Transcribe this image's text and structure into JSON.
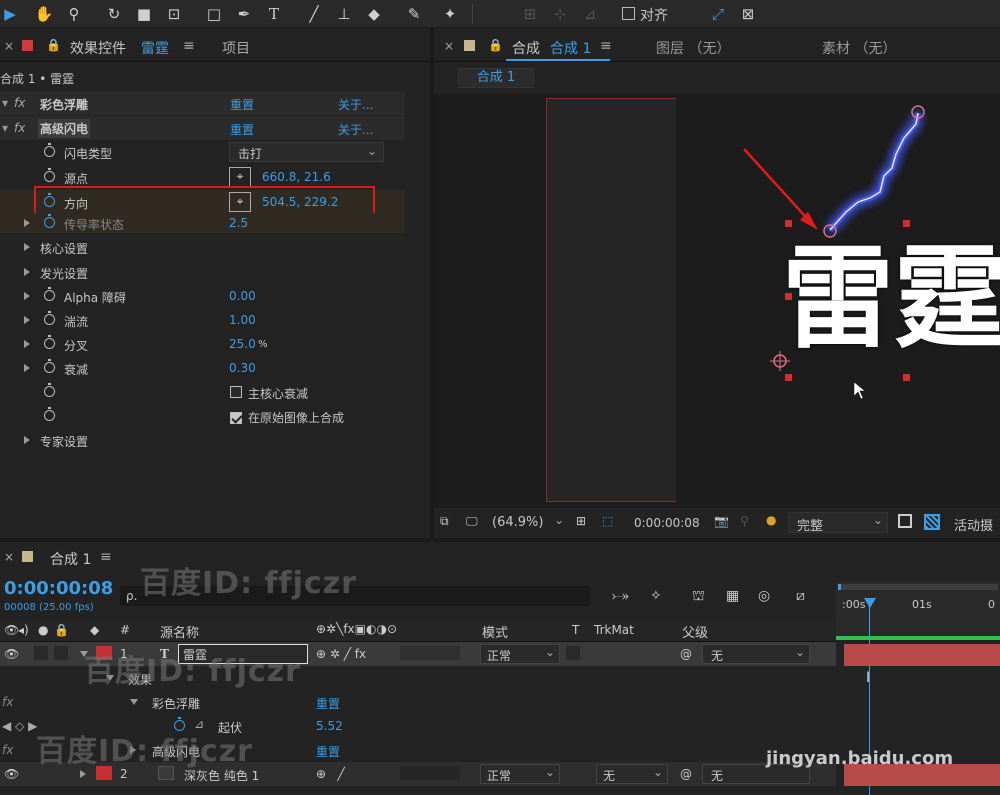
{
  "toolbar": {
    "align_label": "对齐"
  },
  "effects_panel": {
    "tab_prefix": "效果控件",
    "tab_layer": "雷霆",
    "tab_project": "项目",
    "subtitle": "合成 1 • 雷霆",
    "rows": [
      {
        "name": "彩色浮雕",
        "reset": "重置",
        "about": "关于..."
      },
      {
        "name": "高级闪电",
        "reset": "重置",
        "about": "关于..."
      }
    ],
    "lightning_type": {
      "label": "闪电类型",
      "value": "击打"
    },
    "origin": {
      "label": "源点",
      "value": "660.8, 21.6"
    },
    "direction": {
      "label": "方向",
      "value": "504.5, 229.2"
    },
    "conductivity": {
      "label": "传导率状态",
      "value": "2.5"
    },
    "core": {
      "label": "核心设置"
    },
    "glow": {
      "label": "发光设置"
    },
    "alpha": {
      "label": "Alpha 障碍",
      "value": "0.00"
    },
    "turbulence": {
      "label": "湍流",
      "value": "1.00"
    },
    "fork": {
      "label": "分叉",
      "value": "25.0",
      "unit": "%"
    },
    "decay": {
      "label": "衰减",
      "value": "0.30"
    },
    "main_core_decay": {
      "label": "主核心衰减",
      "checked": false
    },
    "composite": {
      "label": "在原始图像上合成",
      "checked": true
    },
    "expert": {
      "label": "专家设置"
    }
  },
  "comp_panel": {
    "tab_comp": "合成",
    "tab_name": "合成 1",
    "tab_layer": "图层 （无）",
    "tab_footage": "素材 （无）",
    "chip": "合成 1",
    "canvas_text": "雷霆",
    "zoom": "(64.9%)",
    "timecode": "0:00:00:08",
    "quality": "完整",
    "active_camera": "活动摄"
  },
  "timeline": {
    "tab": "合成 1",
    "timecode": "0:00:00:08",
    "fps": "00008 (25.00 fps)",
    "search_placeholder": "ρ.",
    "cols": {
      "num": "#",
      "source": "源名称",
      "mode": "模式",
      "t": "T",
      "trkmat": "TrkMat",
      "parent": "父级"
    },
    "ruler": {
      "t0": ":00s",
      "t1": "01s",
      "t2": "0"
    },
    "layer1": {
      "num": "1",
      "type": "T",
      "name": "雷霆",
      "mode": "正常",
      "parent": "无"
    },
    "effects_label": "效果",
    "emboss_label": "彩色浮雕",
    "emboss_reset": "重置",
    "relief_label": "起伏",
    "relief_value": "5.52",
    "lightning_label": "高级闪电",
    "lightning_reset": "重置",
    "layer2": {
      "num": "2",
      "name": "深灰色 纯色 1",
      "mode": "正常",
      "trk": "无",
      "parent": "无"
    }
  },
  "watermark": {
    "text": "百度ID: ffjczr",
    "footer": "jingyan.baidu.com"
  },
  "colors": {
    "accent": "#3d9ee6",
    "highlight_box": "#e0191c",
    "arrow": "#e21b1b",
    "layer_red": "#c73030"
  }
}
